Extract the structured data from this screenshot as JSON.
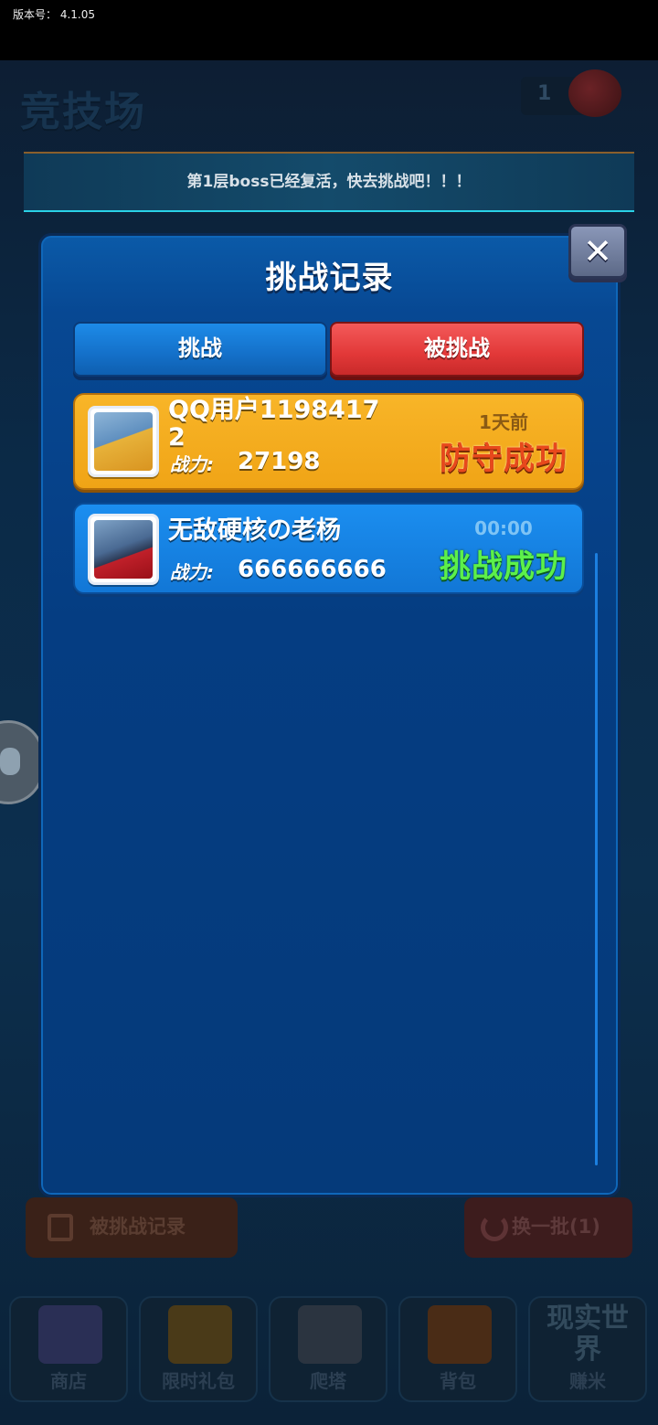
{
  "status_bar": {
    "version_label": "版本号：",
    "version": "4.1.05"
  },
  "background": {
    "page_title": "竞技场",
    "count": "1",
    "banner": "第1层boss已经复活，快去挑战吧！！！",
    "left_button": "被挑战记录",
    "right_button": "换一批(1)",
    "nav": [
      {
        "label": "商店",
        "icon": "shop-icon"
      },
      {
        "label": "限时礼包",
        "icon": "gift-box-icon"
      },
      {
        "label": "爬塔",
        "icon": "crossed-swords-icon"
      },
      {
        "label": "背包",
        "icon": "backpack-icon"
      },
      {
        "label": "赚米",
        "icon": "real-world-icon",
        "overlay": "现实世界"
      }
    ]
  },
  "modal": {
    "title": "挑战记录",
    "close_icon": "close-icon",
    "tabs": {
      "challenge": "挑战",
      "challenged": "被挑战"
    },
    "records": [
      {
        "name": "QQ用户11984172",
        "power_label": "战力:",
        "power": "27198",
        "time": "1天前",
        "result": "防守成功",
        "result_color": "#e8481c",
        "bg": "#f4ab1c"
      },
      {
        "name": "无敌硬核の老杨",
        "power_label": "战力:",
        "power": "666666666",
        "time": "00:00",
        "result": "挑战成功",
        "result_color": "#5cf04a",
        "bg": "#1784e6"
      }
    ]
  }
}
